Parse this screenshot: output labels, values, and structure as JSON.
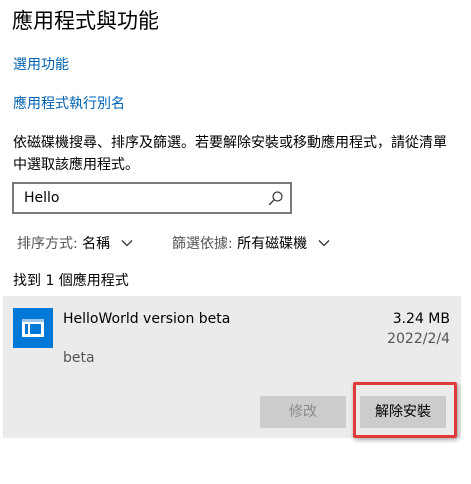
{
  "header": {
    "title": "應用程式與功能"
  },
  "links": {
    "optional_features": "選用功能",
    "app_execution_alias": "應用程式執行別名"
  },
  "description": "依磁碟機搜尋、排序及篩選。若要解除安裝或移動應用程式，請從清單中選取該應用程式。",
  "search": {
    "value": "Hello",
    "icon": "search-icon"
  },
  "filters": {
    "sort_label": "排序方式:",
    "sort_value": "名稱",
    "drive_label": "篩選依據:",
    "drive_value": "所有磁碟機"
  },
  "result_count": "找到 1 個應用程式",
  "apps": [
    {
      "name": "HelloWorld version beta",
      "size": "3.24 MB",
      "date": "2022/2/4",
      "publisher": "beta",
      "icon": "app-window-icon",
      "icon_color": "#0078d7",
      "modify_label": "修改",
      "uninstall_label": "解除安裝"
    }
  ],
  "colors": {
    "link": "#0063b1",
    "accent": "#0078d7",
    "highlight": "#e23a3a",
    "card_background": "#ebebeb"
  }
}
